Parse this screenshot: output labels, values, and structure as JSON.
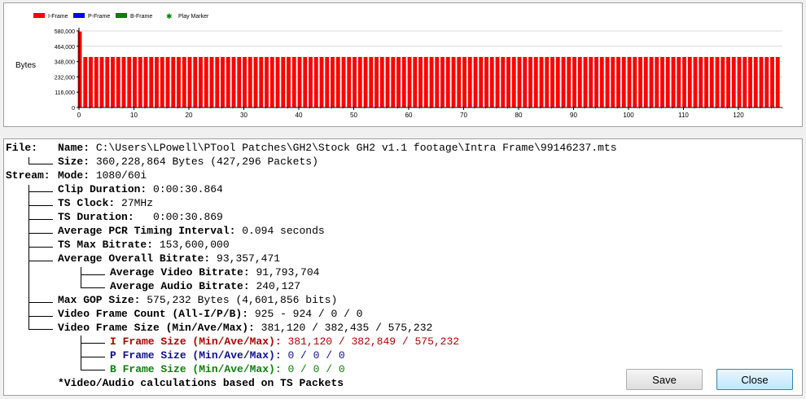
{
  "chart": {
    "legend": [
      {
        "label": "I-Frame",
        "color": "#ff0000"
      },
      {
        "label": "P-Frame",
        "color": "#0000ff"
      },
      {
        "label": "B-Frame",
        "color": "#008000"
      },
      {
        "label": "Play Marker",
        "color": "#008000"
      }
    ],
    "ylabel": "Bytes"
  },
  "chart_data": {
    "type": "bar",
    "x_ticks": [
      0,
      10,
      20,
      30,
      40,
      50,
      60,
      70,
      80,
      90,
      100,
      110,
      120
    ],
    "y_ticks": [
      "0",
      "116,000",
      "232,000",
      "348,000",
      "464,000",
      "580,000"
    ],
    "ylim": [
      0,
      580000
    ],
    "xlim": [
      0,
      128
    ],
    "series": [
      {
        "name": "I-Frame",
        "color": "#ff0000",
        "values": [
          575232,
          382800,
          382900,
          382700,
          382850,
          382750,
          382900,
          382800,
          382700,
          382850,
          382900,
          382800,
          382750,
          382850,
          382900,
          382700,
          382800,
          382850,
          382750,
          382900,
          382800,
          382850,
          382700,
          382900,
          382800,
          382750,
          382850,
          382900,
          382800,
          382700,
          382850,
          382900,
          382750,
          382800,
          382850,
          382900,
          382700,
          382800,
          382850,
          382750,
          382900,
          382800,
          382850,
          382700,
          382900,
          382800,
          382750,
          382850,
          382900,
          382800,
          382700,
          382850,
          382900,
          382750,
          382800,
          382850,
          382900,
          382700,
          382800,
          382850,
          382750,
          382900,
          382800,
          382850,
          382700,
          382900,
          382800,
          382750,
          382850,
          382900,
          382800,
          382700,
          382850,
          382900,
          382750,
          382800,
          382850,
          382900,
          382700,
          382800,
          382850,
          382750,
          382900,
          382800,
          382850,
          382700,
          382900,
          382800,
          382750,
          382850,
          382900,
          382800,
          382700,
          382850,
          382900,
          382750,
          382800,
          382850,
          382900,
          382700,
          382800,
          382850,
          382750,
          382900,
          382800,
          382850,
          382700,
          382900,
          382800,
          382750,
          382850,
          382900,
          382800,
          382700,
          382850,
          382900,
          382750,
          382800,
          382850,
          382900,
          382700,
          382800,
          382850,
          382750,
          382900,
          382800,
          382850,
          382700
        ]
      }
    ]
  },
  "file": {
    "label": "File:",
    "name_label": "Name:",
    "name_value": "C:\\Users\\LPowell\\PTool Patches\\GH2\\Stock GH2 v1.1 footage\\Intra Frame\\99146237.mts",
    "size_label": "Size:",
    "size_value": "360,228,864 Bytes (427,296 Packets)"
  },
  "stream": {
    "label": "Stream:",
    "mode_label": "Mode:",
    "mode_value": "1080/60i",
    "clip_duration_label": "Clip Duration:",
    "clip_duration_value": "0:00:30.864",
    "ts_clock_label": "TS Clock:",
    "ts_clock_value": "27MHz",
    "ts_duration_label": "TS Duration:",
    "ts_duration_value": "0:00:30.869",
    "pcr_label": "Average PCR Timing Interval:",
    "pcr_value": "0.094 seconds",
    "ts_max_label": "TS Max Bitrate:",
    "ts_max_value": "153,600,000",
    "overall_label": "Average Overall Bitrate:",
    "overall_value": "93,357,471",
    "video_bitrate_label": "Average Video Bitrate:",
    "video_bitrate_value": "91,793,704",
    "audio_bitrate_label": "Average Audio Bitrate:",
    "audio_bitrate_value": "240,127",
    "gop_label": "Max GOP Size:",
    "gop_value": "575,232 Bytes (4,601,856 bits)",
    "frame_count_label": "Video Frame Count (All-I/P/B):",
    "frame_count_value": "925 - 924 / 0 / 0",
    "frame_size_label": "Video Frame Size (Min/Ave/Max):",
    "frame_size_value": "381,120 / 382,435 / 575,232",
    "i_size_label": "I Frame Size (Min/Ave/Max):",
    "i_size_value": "381,120 / 382,849 / 575,232",
    "p_size_label": "P Frame Size (Min/Ave/Max):",
    "p_size_value": "0 / 0 / 0",
    "b_size_label": "B Frame Size (Min/Ave/Max):",
    "b_size_value": "0 / 0 / 0",
    "note": "*Video/Audio calculations based on TS Packets"
  },
  "buttons": {
    "save": "Save",
    "close": "Close"
  }
}
